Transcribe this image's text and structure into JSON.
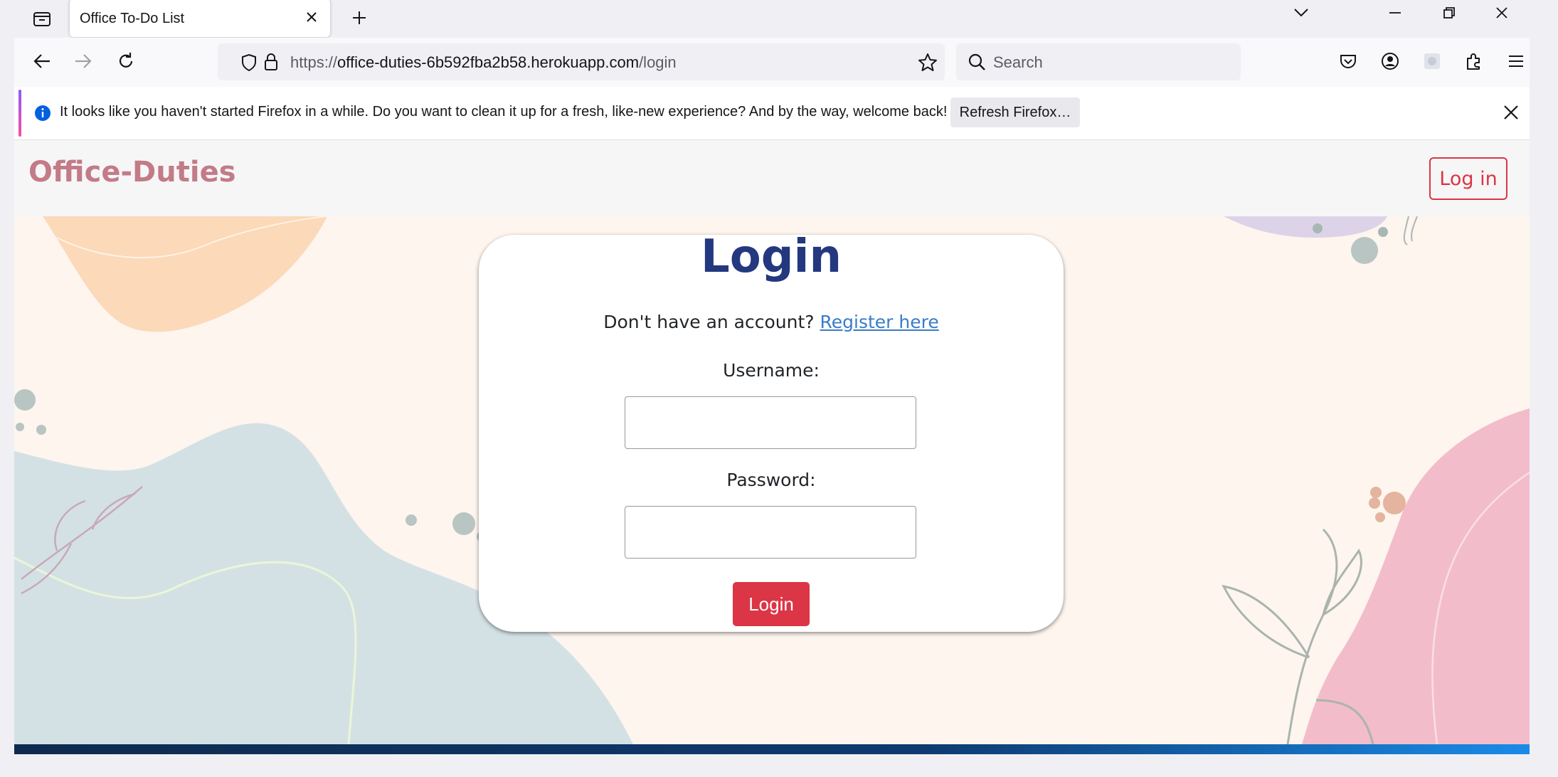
{
  "browser": {
    "tab": {
      "title": "Office To-Do List"
    },
    "url": {
      "scheme": "https://",
      "host": "office-duties-6b592fba2b58.herokuapp.com",
      "path": "/login"
    },
    "search": {
      "placeholder": "Search"
    },
    "notification": {
      "message": "It looks like you haven't started Firefox in a while. Do you want to clean it up for a fresh, like-new experience? And by the way, welcome back!",
      "button_label": "Refresh Firefox…"
    }
  },
  "site": {
    "brand": "Office-Duties",
    "nav_login": "Log in"
  },
  "login": {
    "title": "Login",
    "prompt": "Don't have an account?",
    "register_link": "Register here",
    "username_label": "Username:",
    "username_value": "",
    "password_label": "Password:",
    "password_value": "",
    "submit_label": "Login"
  },
  "colors": {
    "brand": "#c27b87",
    "accent": "#dc3545",
    "title": "#24387f",
    "link": "#3a7cc8"
  }
}
